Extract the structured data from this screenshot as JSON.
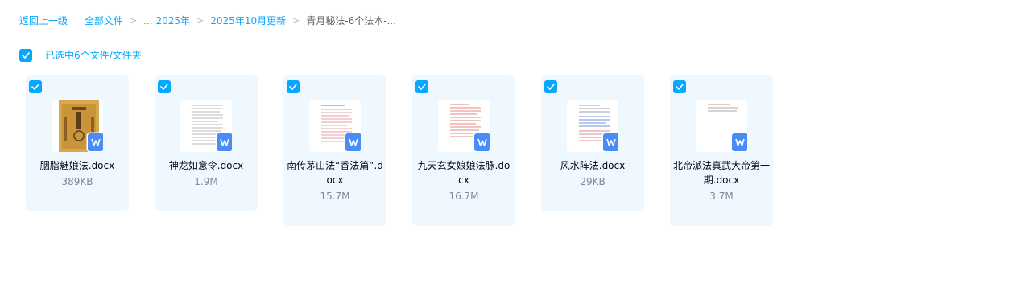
{
  "breadcrumb": {
    "back": "返回上一级",
    "all_files": "全部文件",
    "ellipsis_2025": "... 2025年",
    "month": "2025年10月更新",
    "current": "青月秘法-6个法本-..."
  },
  "selection": {
    "label": "已选中6个文件/文件夹"
  },
  "files": [
    {
      "name": "胭脂魅娘法.docx",
      "size": "389KB",
      "thumbnail": "ancient-book-scan"
    },
    {
      "name": "神龙如意令.docx",
      "size": "1.9M",
      "thumbnail": "text-document"
    },
    {
      "name": "南传茅山法“香法篇”.docx",
      "size": "15.7M",
      "thumbnail": "red-text-document"
    },
    {
      "name": "九天玄女娘娘法脉.docx",
      "size": "16.7M",
      "thumbnail": "red-text-document"
    },
    {
      "name": "风水阵法.docx",
      "size": "29KB",
      "thumbnail": "blue-red-text-document"
    },
    {
      "name": "北帝派法真武大帝第一期.docx",
      "size": "3.7M",
      "thumbnail": "sparse-text-document"
    }
  ],
  "colors": {
    "accent": "#06a7ff",
    "card_bg": "#f0f8ff",
    "wps_blue": "#4a8cf7"
  }
}
